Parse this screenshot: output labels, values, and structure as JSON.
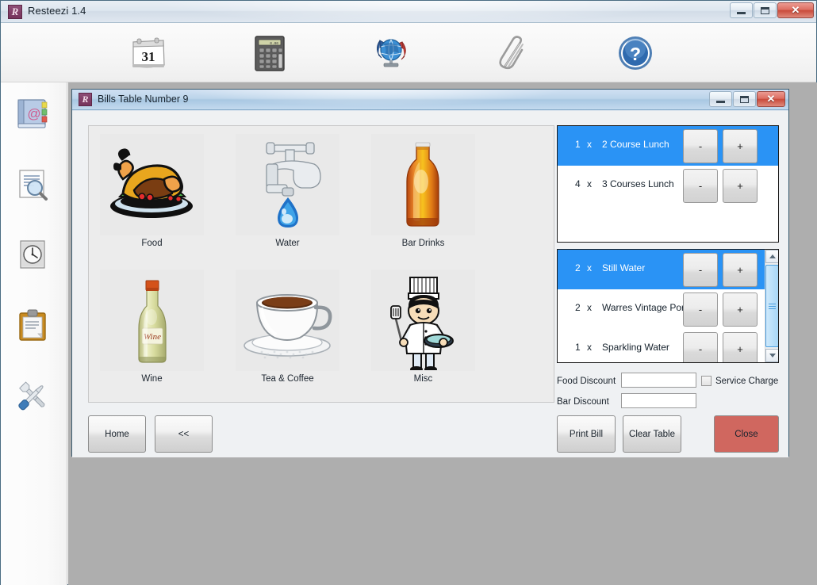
{
  "app": {
    "title": "Resteezi 1.4",
    "icon_letter": "R",
    "icon_name": "app-logo-r",
    "window_controls": {
      "minimize": "minimize",
      "maximize": "maximize",
      "close": "✕"
    }
  },
  "toolbar": {
    "items": [
      {
        "icon": "calendar-icon",
        "label": "Calendar",
        "badge": "31"
      },
      {
        "icon": "calculator-icon",
        "label": "Calculator"
      },
      {
        "icon": "globe-sync-icon",
        "label": "Internet / Sync"
      },
      {
        "icon": "paperclip-icon",
        "label": "Attachments"
      },
      {
        "icon": "help-question-icon",
        "label": "Help"
      }
    ]
  },
  "sidebar": {
    "items": [
      {
        "icon": "address-book-icon",
        "label": "Contacts"
      },
      {
        "icon": "document-search-icon",
        "label": "Find"
      },
      {
        "icon": "clock-document-icon",
        "label": "History"
      },
      {
        "icon": "clipboard-icon",
        "label": "Orders"
      },
      {
        "icon": "tools-icon",
        "label": "Settings"
      }
    ]
  },
  "child_window": {
    "title": "Bills Table Number 9",
    "icon_letter": "R",
    "window_controls": {
      "minimize": "minimize",
      "maximize": "maximize",
      "close": "✕"
    }
  },
  "categories": [
    {
      "label": "Food",
      "icon": "roast-dinner-icon"
    },
    {
      "label": "Water",
      "icon": "tap-water-droplet-icon"
    },
    {
      "label": "Bar Drinks",
      "icon": "beer-bottle-icon"
    },
    {
      "label": "Wine",
      "icon": "wine-bottle-icon"
    },
    {
      "label": "Tea & Coffee",
      "icon": "coffee-cup-icon"
    },
    {
      "label": "Misc",
      "icon": "chef-icon"
    }
  ],
  "nav_buttons": {
    "home": "Home",
    "back": "<<"
  },
  "food_list": {
    "rows": [
      {
        "qty": "1",
        "sep": "x",
        "name": "2 Course Lunch",
        "selected": true,
        "minus": "-",
        "plus": "+"
      },
      {
        "qty": "4",
        "sep": "x",
        "name": "3 Courses Lunch",
        "selected": false,
        "minus": "-",
        "plus": "+"
      }
    ]
  },
  "drinks_list": {
    "rows": [
      {
        "qty": "2",
        "sep": "x",
        "name": "Still Water",
        "selected": true,
        "minus": "-",
        "plus": "+"
      },
      {
        "qty": "2",
        "sep": "x",
        "name": "Warres Vintage Port",
        "selected": false,
        "minus": "-",
        "plus": "+"
      },
      {
        "qty": "1",
        "sep": "x",
        "name": "Sparkling Water",
        "selected": false,
        "minus": "-",
        "plus": "+"
      }
    ],
    "scrollbar": {
      "up": "▲",
      "down": "▼"
    }
  },
  "discounts": {
    "food_label": "Food Discount",
    "food_value": "",
    "food_placeholder": "",
    "bar_label": "Bar Discount",
    "bar_value": "",
    "bar_placeholder": "",
    "service_charge_label": "Service Charge",
    "service_charge_checked": false
  },
  "action_buttons": {
    "print_bill": "Print Bill",
    "clear_table": "Clear Table",
    "close": "Close"
  },
  "colors": {
    "selection_blue": "#2a93f5",
    "close_red": "#d0675f",
    "child_title_blue": "#a8c7e2",
    "mdi_gray": "#aeaeae"
  }
}
